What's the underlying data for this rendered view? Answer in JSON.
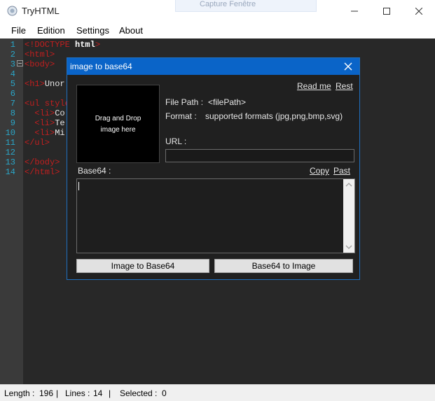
{
  "window": {
    "title": "TryHTML",
    "ghost_title": "Capture Fenêtre"
  },
  "menu": [
    "File",
    "Edition",
    "Settings",
    "About"
  ],
  "editor": {
    "line_numbers": [
      "1",
      "2",
      "3",
      "4",
      "5",
      "6",
      "7",
      "8",
      "9",
      "10",
      "11",
      "12",
      "13",
      "14"
    ],
    "lines": [
      {
        "parts": [
          {
            "t": "<!DOCTYPE",
            "c": "tag"
          },
          {
            "t": " html",
            "c": "kw"
          },
          {
            "t": ">",
            "c": "tag"
          }
        ]
      },
      {
        "parts": [
          {
            "t": "<html>",
            "c": "tag"
          }
        ]
      },
      {
        "parts": [
          {
            "t": "<body>",
            "c": "tag"
          }
        ]
      },
      {
        "parts": []
      },
      {
        "parts": [
          {
            "t": "<h1>",
            "c": "tag"
          },
          {
            "t": "Unor",
            "c": "txt"
          }
        ]
      },
      {
        "parts": []
      },
      {
        "parts": [
          {
            "t": "<ul style",
            "c": "tag"
          }
        ]
      },
      {
        "parts": [
          {
            "t": "  <li>",
            "c": "tag"
          },
          {
            "t": "Co",
            "c": "txt"
          }
        ]
      },
      {
        "parts": [
          {
            "t": "  <li>",
            "c": "tag"
          },
          {
            "t": "Te",
            "c": "txt"
          }
        ]
      },
      {
        "parts": [
          {
            "t": "  <li>",
            "c": "tag"
          },
          {
            "t": "Mi",
            "c": "txt"
          }
        ]
      },
      {
        "parts": [
          {
            "t": "</ul>",
            "c": "tag"
          }
        ]
      },
      {
        "parts": []
      },
      {
        "parts": [
          {
            "t": "</body>",
            "c": "tag"
          }
        ]
      },
      {
        "parts": [
          {
            "t": "</html>",
            "c": "tag"
          }
        ]
      }
    ]
  },
  "dialog": {
    "title": "image to base64",
    "drop_line1": "Drag and Drop",
    "drop_line2": "image here",
    "read_me": "Read me",
    "rest": "Rest",
    "file_path_label": "File Path :",
    "file_path_value": "<filePath>",
    "format_label": "Format :",
    "format_value": "supported formats (jpg,png,bmp,svg)",
    "url_label": "URL :",
    "url_value": "",
    "base64_label": "Base64 :",
    "copy": "Copy",
    "past": "Past",
    "base64_value": "",
    "btn_img_to_b64": "Image to Base64",
    "btn_b64_to_img": "Base64 to Image"
  },
  "status": {
    "length_label": "Length :",
    "length_value": "196",
    "lines_label": "Lines :",
    "lines_value": "14",
    "selected_label": "Selected :",
    "selected_value": "0",
    "sep": "|"
  },
  "colors": {
    "accent": "#0a64c8",
    "editor_bg": "#282828",
    "tag": "#c21f1f",
    "line_number": "#2aa6c8"
  }
}
